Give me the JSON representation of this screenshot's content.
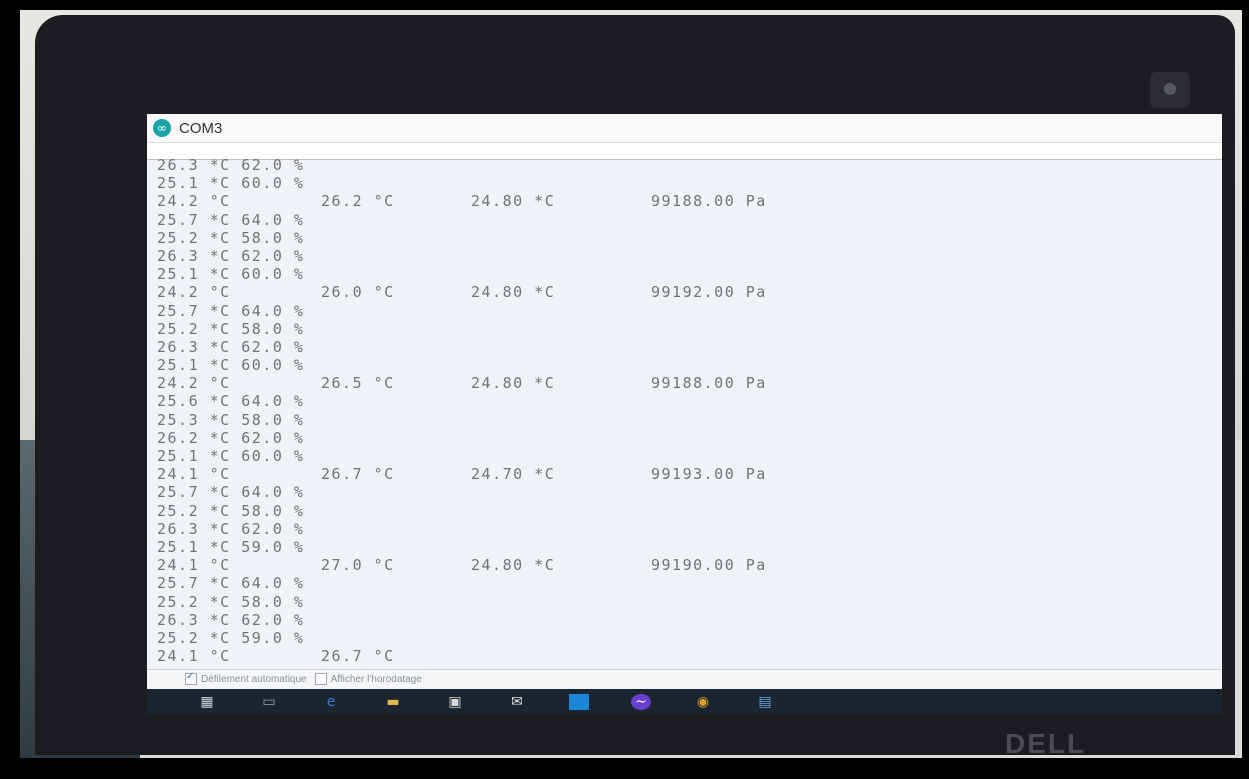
{
  "window": {
    "title": "COM3"
  },
  "serial_output": {
    "lines": [
      [
        "26.3 *C 62.0 %",
        "",
        "",
        ""
      ],
      [
        "25.1 *C 60.0 %",
        "",
        "",
        ""
      ],
      [
        "24.2 °C",
        "26.2 °C",
        "24.80 *C",
        "99188.00 Pa"
      ],
      [
        "25.7 *C 64.0 %",
        "",
        "",
        ""
      ],
      [
        "25.2 *C 58.0 %",
        "",
        "",
        ""
      ],
      [
        "26.3 *C 62.0 %",
        "",
        "",
        ""
      ],
      [
        "25.1 *C 60.0 %",
        "",
        "",
        ""
      ],
      [
        "24.2 °C",
        "26.0 °C",
        "24.80 *C",
        "99192.00 Pa"
      ],
      [
        "25.7 *C 64.0 %",
        "",
        "",
        ""
      ],
      [
        "25.2 *C 58.0 %",
        "",
        "",
        ""
      ],
      [
        "26.3 *C 62.0 %",
        "",
        "",
        ""
      ],
      [
        "25.1 *C 60.0 %",
        "",
        "",
        ""
      ],
      [
        "24.2 °C",
        "26.5 °C",
        "24.80 *C",
        "99188.00 Pa"
      ],
      [
        "25.6 *C 64.0 %",
        "",
        "",
        ""
      ],
      [
        "25.3 *C 58.0 %",
        "",
        "",
        ""
      ],
      [
        "26.2 *C 62.0 %",
        "",
        "",
        ""
      ],
      [
        "25.1 *C 60.0 %",
        "",
        "",
        ""
      ],
      [
        "24.1 °C",
        "26.7 °C",
        "24.70 *C",
        "99193.00 Pa"
      ],
      [
        "25.7 *C 64.0 %",
        "",
        "",
        ""
      ],
      [
        "25.2 *C 58.0 %",
        "",
        "",
        ""
      ],
      [
        "26.3 *C 62.0 %",
        "",
        "",
        ""
      ],
      [
        "25.1 *C 59.0 %",
        "",
        "",
        ""
      ],
      [
        "24.1 °C",
        "27.0 °C",
        "24.80 *C",
        "99190.00 Pa"
      ],
      [
        "25.7 *C 64.0 %",
        "",
        "",
        ""
      ],
      [
        "25.2 *C 58.0 %",
        "",
        "",
        ""
      ],
      [
        "26.3 *C 62.0 %",
        "",
        "",
        ""
      ],
      [
        "25.2 *C 59.0 %",
        "",
        "",
        ""
      ],
      [
        "24.1 °C",
        "26.7 °C",
        "",
        ""
      ]
    ]
  },
  "statusbar": {
    "autoscroll_label": "Défilement automatique",
    "autoscroll_checked": true,
    "timestamp_label": "Afficher l'horodatage",
    "timestamp_checked": false
  },
  "taskbar": {
    "icons": [
      "windows-start-icon",
      "task-view-icon",
      "edge-browser-icon",
      "file-explorer-icon",
      "store-icon",
      "mail-icon",
      "app-icon",
      "pulse-app-icon",
      "chrome-icon",
      "arduino-ide-icon"
    ]
  },
  "branding": {
    "laptop_logo": "DELL"
  },
  "colors": {
    "screen_bg": "#eef3f8",
    "text": "#6c747c",
    "taskbar": "#1b2530",
    "bezel": "#1c1d21",
    "arduino_teal": "#1aa3a8"
  }
}
